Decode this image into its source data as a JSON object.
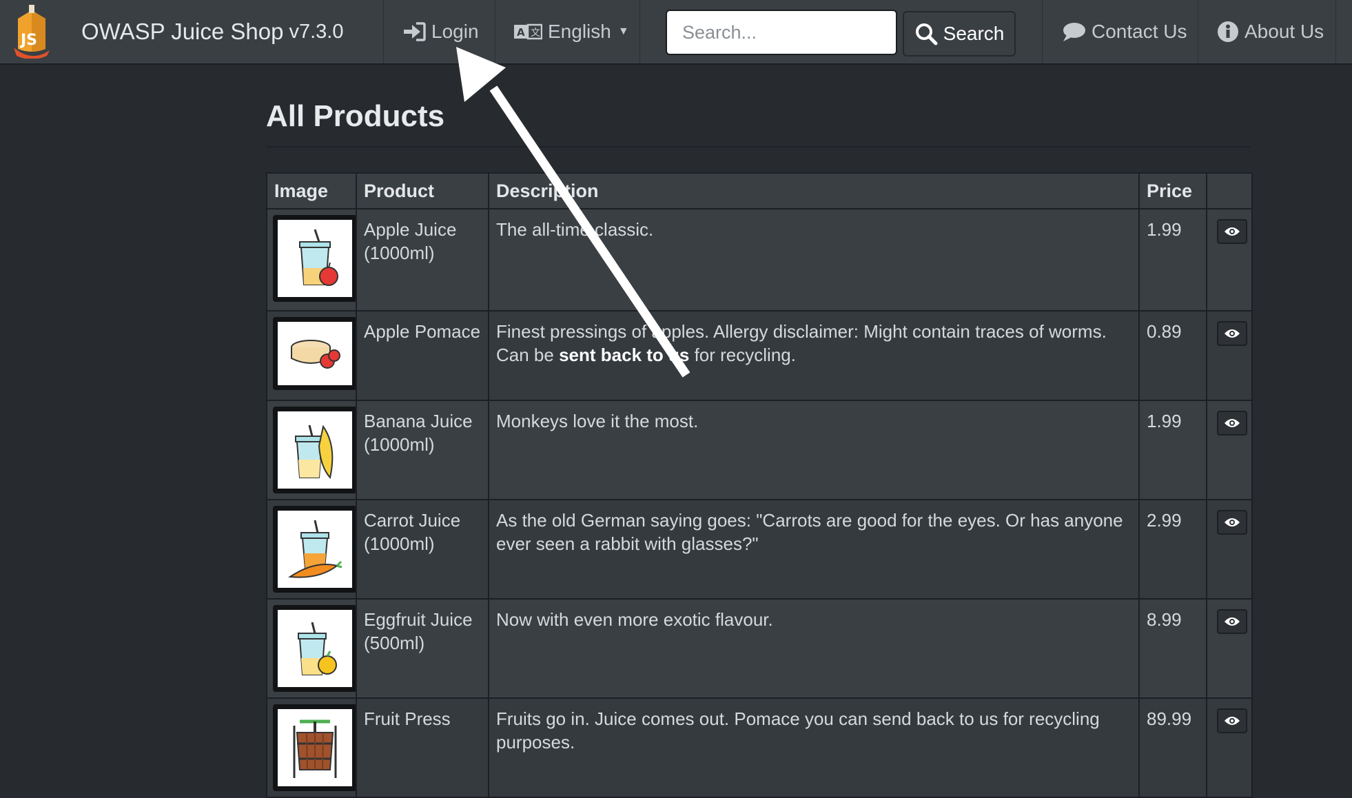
{
  "app": {
    "name": "OWASP Juice Shop",
    "version": "v7.3.0"
  },
  "nav": {
    "login_label": "Login",
    "language_label": "English",
    "search_placeholder": "Search...",
    "search_button_label": "Search",
    "contact_label": "Contact Us",
    "about_label": "About Us"
  },
  "main": {
    "title": "All Products",
    "columns": [
      "Image",
      "Product",
      "Description",
      "Price",
      ""
    ],
    "products": [
      {
        "name": "Apple Juice (1000ml)",
        "description": "The all-time classic.",
        "price": "1.99",
        "image": "apple-juice-icon"
      },
      {
        "name": "Apple Pomace",
        "description_parts": [
          "Finest pressings of apples. Allergy disclaimer: Might contain traces of worms. Can be ",
          "sent back to us",
          " for recycling."
        ],
        "price": "0.89",
        "image": "apple-pomace-icon"
      },
      {
        "name": "Banana Juice (1000ml)",
        "description": "Monkeys love it the most.",
        "price": "1.99",
        "image": "banana-juice-icon"
      },
      {
        "name": "Carrot Juice (1000ml)",
        "description": "As the old German saying goes: \"Carrots are good for the eyes. Or has anyone ever seen a rabbit with glasses?\"",
        "price": "2.99",
        "image": "carrot-juice-icon"
      },
      {
        "name": "Eggfruit Juice (500ml)",
        "description": "Now with even more exotic flavour.",
        "price": "8.99",
        "image": "eggfruit-juice-icon"
      },
      {
        "name": "Fruit Press",
        "description": "Fruits go in. Juice comes out. Pomace you can send back to us for recycling purposes.",
        "price": "89.99",
        "image": "fruit-press-icon"
      }
    ]
  },
  "icons": {
    "logo": "juice-shop-logo",
    "login": "sign-in-icon",
    "language": "language-icon",
    "search": "search-icon",
    "contact": "speech-bubble-icon",
    "about": "info-circle-icon",
    "details": "eye-icon",
    "annotation": "arrow-pointer"
  },
  "colors": {
    "navbar_bg": "#3a3f44",
    "page_bg": "#272b30",
    "annotation_arrow": "#ffffff"
  }
}
